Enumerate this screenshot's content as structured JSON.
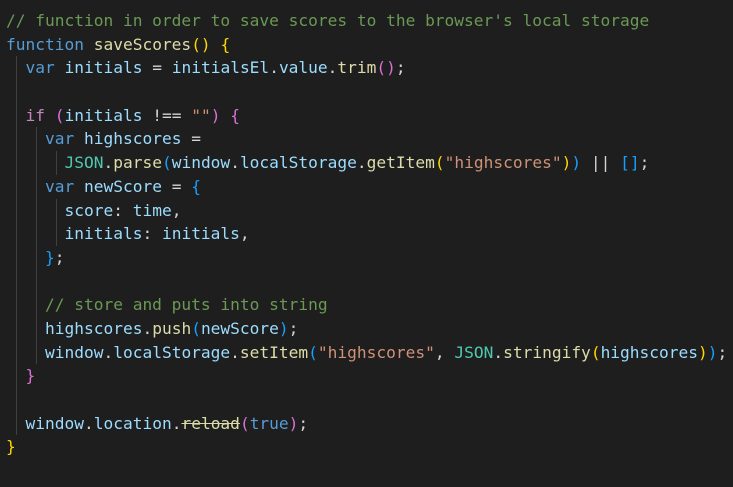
{
  "editor": {
    "theme_colors": {
      "background": "#1e1e1e",
      "comment": "#6a9955",
      "keyword": "#569cd6",
      "control": "#c586c0",
      "function": "#dcdcaa",
      "variable": "#9cdcfe",
      "string": "#ce9178",
      "text": "#d4d4d4",
      "bracket_gold": "#ffd700",
      "bracket_purple": "#da70d6",
      "bracket_blue": "#179fff"
    },
    "lines": [
      "// function in order to save scores to the browser's local storage",
      "function saveScores() {",
      "  var initials = initialsEl.value.trim();",
      "",
      "  if (initials !== \"\") {",
      "    var highscores =",
      "      JSON.parse(window.localStorage.getItem(\"highscores\")) || [];",
      "    var newScore = {",
      "      score: time,",
      "      initials: initials,",
      "    };",
      "",
      "    // store and puts into string",
      "    highscores.push(newScore);",
      "    window.localStorage.setItem(\"highscores\", JSON.stringify(highscores));",
      "  }",
      "",
      "  window.location.reload(true);",
      "}"
    ],
    "tokens": {
      "l1_comment": "// function in order to save scores to the browser's local storage",
      "kw_function": "function",
      "fn_saveScores": "saveScores",
      "kw_var": "var",
      "id_initials": "initials",
      "op_eq": "=",
      "id_initialsEl": "initialsEl",
      "id_value": "value",
      "fn_trim": "trim",
      "kw_if": "if",
      "op_neq": "!==",
      "str_empty": "\"\"",
      "id_highscores": "highscores",
      "id_JSON": "JSON",
      "fn_parse": "parse",
      "id_window": "window",
      "id_localStorage": "localStorage",
      "fn_getItem": "getItem",
      "str_highscores": "\"highscores\"",
      "op_or": "||",
      "id_newScore": "newScore",
      "id_score": "score",
      "id_time": "time",
      "l13_comment": "// store and puts into string",
      "fn_push": "push",
      "fn_setItem": "setItem",
      "fn_stringify": "stringify",
      "id_location": "location",
      "fn_reload": "reload",
      "kw_true": "true"
    }
  }
}
